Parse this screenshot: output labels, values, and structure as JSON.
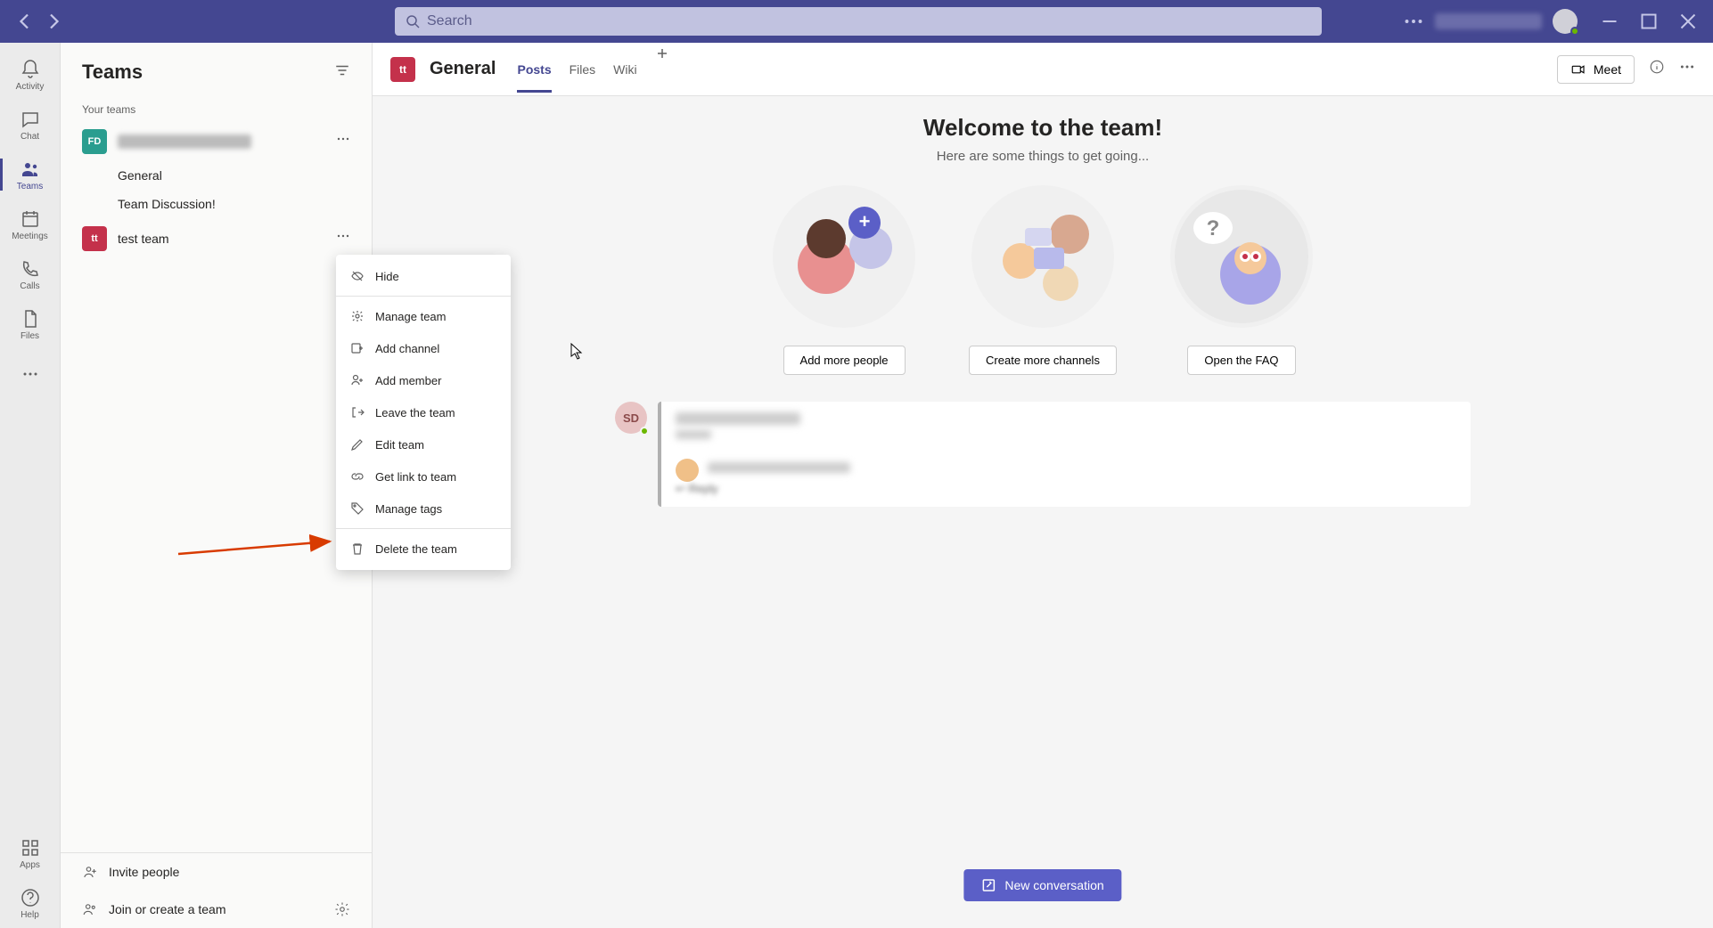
{
  "titlebar": {
    "search_placeholder": "Search"
  },
  "rail": {
    "activity": "Activity",
    "chat": "Chat",
    "teams": "Teams",
    "meetings": "Meetings",
    "calls": "Calls",
    "files": "Files",
    "apps": "Apps",
    "help": "Help"
  },
  "panel": {
    "title": "Teams",
    "section_your_teams": "Your teams",
    "teams": [
      {
        "initials": "FD",
        "channels": [
          "General",
          "Team Discussion!"
        ]
      },
      {
        "initials": "tt",
        "name": "test team"
      }
    ],
    "footer_invite": "Invite people",
    "footer_join": "Join or create a team"
  },
  "context_menu": {
    "hide": "Hide",
    "manage_team": "Manage team",
    "add_channel": "Add channel",
    "add_member": "Add member",
    "leave_team": "Leave the team",
    "edit_team": "Edit team",
    "get_link": "Get link to team",
    "manage_tags": "Manage tags",
    "delete_team": "Delete the team"
  },
  "header": {
    "channel_initials": "tt",
    "channel_name": "General",
    "tabs": {
      "posts": "Posts",
      "files": "Files",
      "wiki": "Wiki"
    },
    "meet": "Meet"
  },
  "welcome": {
    "title": "Welcome to the team!",
    "subtitle": "Here are some things to get going...",
    "cards": {
      "add_people": "Add more people",
      "create_channels": "Create more channels",
      "open_faq": "Open the FAQ"
    }
  },
  "post": {
    "author_initials": "SD"
  },
  "compose": {
    "new_conversation": "New conversation"
  }
}
